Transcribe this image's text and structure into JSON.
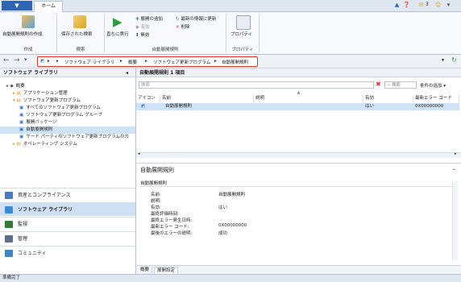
{
  "tabs": {
    "home": "ホーム"
  },
  "topbar": {
    "notification_count": "3"
  },
  "ribbon": {
    "create_btn": "自動展開規則の作成",
    "create_group": "作成",
    "saved_search_btn": "保存された検索",
    "search_group": "検索",
    "run_now_btn": "直ちに実行",
    "add_deploy": "展開の追加",
    "update_last": "最新の情報に更新",
    "enable": "有効",
    "delete": "削除",
    "disable": "無効",
    "rule_group": "自動展開規則",
    "properties_btn": "プロパティ",
    "properties_group": "プロパティ"
  },
  "nav": {
    "crumbs": [
      "ソフトウェア ライブラリ",
      "概要",
      "ソフトウェア更新プログラム",
      "自動展開規則"
    ]
  },
  "left": {
    "title": "ソフトウェア ライブラリ",
    "tree": [
      {
        "label": "概要",
        "indent": 0
      },
      {
        "label": "アプリケーション管理",
        "indent": 1
      },
      {
        "label": "ソフトウェア更新プログラム",
        "indent": 1
      },
      {
        "label": "すべてのソフトウェア更新プログラム",
        "indent": 2
      },
      {
        "label": "ソフトウェア更新プログラム グループ",
        "indent": 2
      },
      {
        "label": "展開パッケージ",
        "indent": 2
      },
      {
        "label": "自動展開規則",
        "indent": 2,
        "selected": true
      },
      {
        "label": "サード パーティのソフトウェア更新プログラムのカ",
        "indent": 2
      },
      {
        "label": "オペレーティング システム",
        "indent": 1
      }
    ],
    "workspaces": [
      {
        "label": "資産とコンプライアンス",
        "active": false,
        "color": "#4a7bc1"
      },
      {
        "label": "ソフトウェア ライブラリ",
        "active": true,
        "color": "#3d8ad4"
      },
      {
        "label": "監視",
        "active": false,
        "color": "#2e7d32"
      },
      {
        "label": "管理",
        "active": false,
        "color": "#5c6f86"
      },
      {
        "label": "コミュニティ",
        "active": false,
        "color": "#3f86c6"
      }
    ]
  },
  "list": {
    "title": "自動展開規則 1 項目",
    "search_placeholder": "検索",
    "search_btn": "検索",
    "add_criteria": "条件の追加",
    "columns": [
      "アイコン",
      "名前",
      "説明",
      "有効",
      "最新エラー コード"
    ],
    "rows": [
      {
        "name": "自動展開規則",
        "description": "",
        "enabled": "はい",
        "error_code": "0X00000000"
      }
    ]
  },
  "detail": {
    "title": "自動展開規則",
    "section": "自動展開規則",
    "fields": [
      {
        "label": "名前:",
        "value": "自動展開規則"
      },
      {
        "label": "説明:",
        "value": ""
      },
      {
        "label": "有効:",
        "value": "はい"
      },
      {
        "label": "最終評価時刻:",
        "value": ""
      },
      {
        "label": "最終エラー発生日時:",
        "value": ""
      },
      {
        "label": "最新エラー コード:",
        "value": "0X00000000"
      },
      {
        "label": "最後のエラーの説明:",
        "value": "成功"
      }
    ],
    "tabs": [
      "概要",
      "展開設定"
    ]
  },
  "status": {
    "text": "準備完了"
  }
}
